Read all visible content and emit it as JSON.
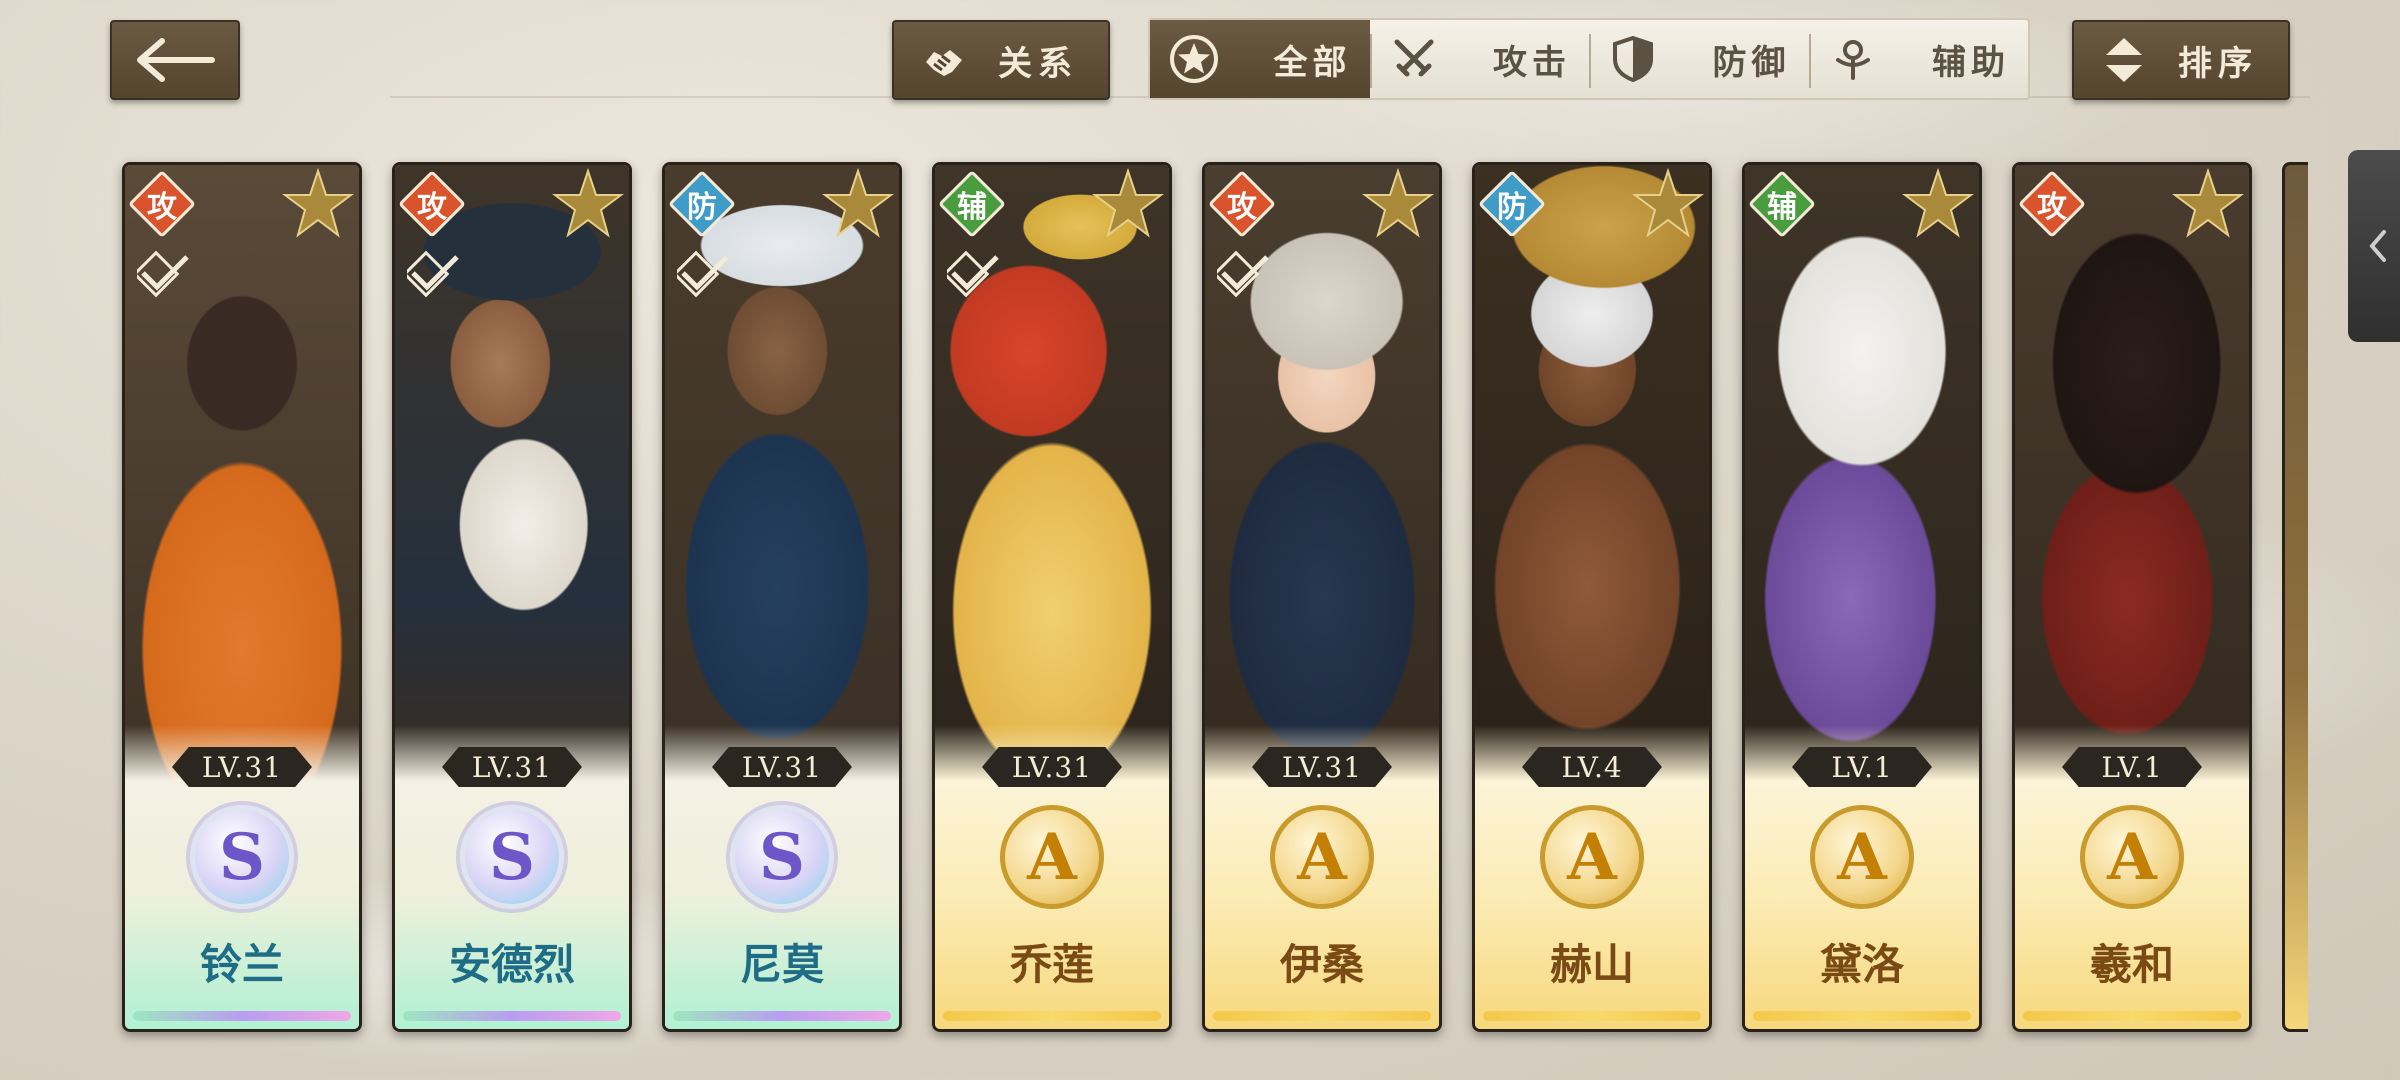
{
  "header": {
    "relation_label": "关系",
    "sort_label": "排序",
    "filters": [
      {
        "label": "全部",
        "icon": "star-circle-icon",
        "active": true
      },
      {
        "label": "攻击",
        "icon": "crossed-swords-icon",
        "active": false
      },
      {
        "label": "防御",
        "icon": "shield-icon",
        "active": false
      },
      {
        "label": "辅助",
        "icon": "support-icon",
        "active": false
      }
    ]
  },
  "cards": [
    {
      "role": "攻",
      "level": "LV.31",
      "rank": "S",
      "name": "铃兰",
      "role_color": "#d9532c"
    },
    {
      "role": "攻",
      "level": "LV.31",
      "rank": "S",
      "name": "安德烈",
      "role_color": "#d9532c"
    },
    {
      "role": "防",
      "level": "LV.31",
      "rank": "S",
      "name": "尼莫",
      "role_color": "#3f9bc7"
    },
    {
      "role": "辅",
      "level": "LV.31",
      "rank": "A",
      "name": "乔莲",
      "role_color": "#4a9d3f"
    },
    {
      "role": "攻",
      "level": "LV.31",
      "rank": "A",
      "name": "伊桑",
      "role_color": "#d9532c"
    },
    {
      "role": "防",
      "level": "LV.4",
      "rank": "A",
      "name": "赫山",
      "role_color": "#3f9bc7"
    },
    {
      "role": "辅",
      "level": "LV.1",
      "rank": "A",
      "name": "黛洛",
      "role_color": "#4a9d3f"
    },
    {
      "role": "攻",
      "level": "LV.1",
      "rank": "A",
      "name": "羲和",
      "role_color": "#d9532c"
    }
  ]
}
